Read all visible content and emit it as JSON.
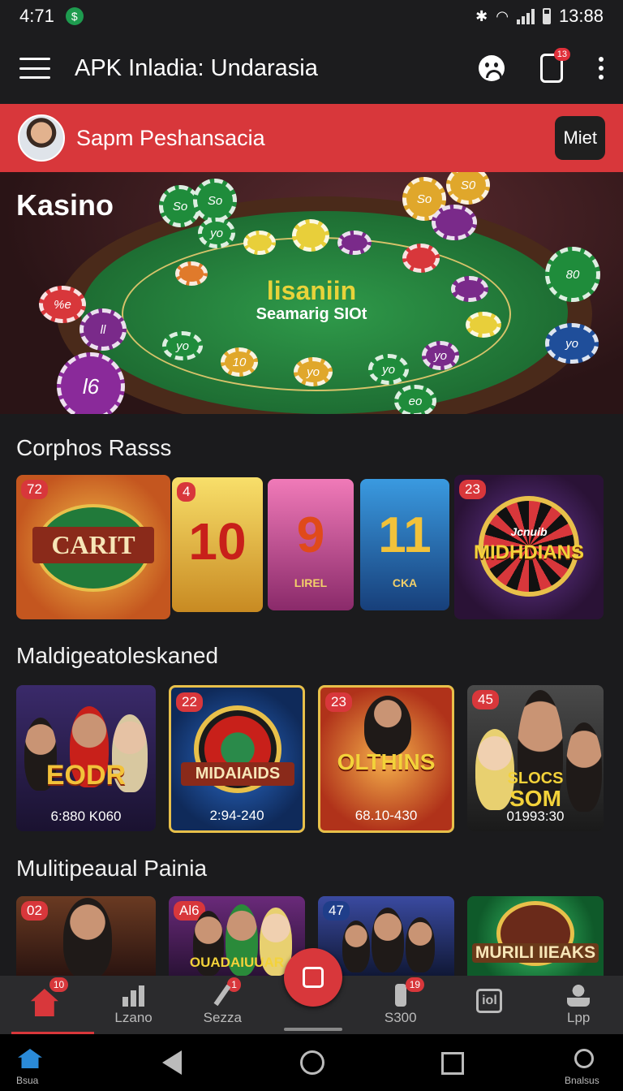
{
  "status_bar": {
    "time": "4:71",
    "clock": "13:88"
  },
  "app_bar": {
    "title": "APK  Inladia: Undarasia",
    "notification_count": "13"
  },
  "user_banner": {
    "name": "Sapm Peshansacia",
    "button": "Miet"
  },
  "hero": {
    "label": "Kasino",
    "felt_title": "lisaniin",
    "felt_subtitle": "Seamarig SIOt",
    "chips": [
      "So",
      "So",
      "yo",
      "S0",
      "So",
      "80",
      "%e",
      "ll",
      "yo",
      "10",
      "yo",
      "yo",
      "l6",
      "yo",
      "yo",
      "eo"
    ]
  },
  "section1": {
    "title": "Corphos Rasss",
    "tiles": [
      {
        "badge": "72",
        "text": "CARIT"
      },
      {
        "badge": "4",
        "text": "10"
      },
      {
        "badge": "",
        "text": "9",
        "sub": "LIREL"
      },
      {
        "badge": "",
        "text": "11",
        "sub": "CKA"
      },
      {
        "badge": "23",
        "text": "MIDHDIANS",
        "sub": "Jcnuib"
      }
    ]
  },
  "section2": {
    "title": "Maldigeatoleskaned",
    "tiles": [
      {
        "badge": "",
        "text": "EODR",
        "footer": "6:880 K060"
      },
      {
        "badge": "22",
        "text": "MIDAIAIDS",
        "footer": "2:94-240"
      },
      {
        "badge": "23",
        "text": "OLTHINS",
        "footer": "68.10-430"
      },
      {
        "badge": "45",
        "text": "SLOCS",
        "text2": "SOM",
        "footer": "01993:30"
      }
    ]
  },
  "section3": {
    "title": "Mulitipeaual Painia",
    "tiles": [
      {
        "badge": "02",
        "text": ""
      },
      {
        "badge": "Al6",
        "text": "OUADAIUUAR"
      },
      {
        "badge": "47",
        "text": ""
      },
      {
        "badge": "",
        "text": "MURILI IIEAKS"
      }
    ]
  },
  "bottom_nav": {
    "items": [
      {
        "label": "",
        "badge": "10"
      },
      {
        "label": "Lzano",
        "badge": ""
      },
      {
        "label": "Sezza",
        "badge": "1"
      },
      {
        "label": "",
        "badge": ""
      },
      {
        "label": "S300",
        "badge": "19"
      },
      {
        "label": "",
        "badge": ""
      },
      {
        "label": "Lpp",
        "badge": ""
      }
    ]
  },
  "system_nav": {
    "left_label": "Bsua",
    "right_label": "Bnalsus"
  },
  "colors": {
    "accent": "#d8373b",
    "background": "#1b1b1d",
    "felt": "#2f9a4a"
  }
}
